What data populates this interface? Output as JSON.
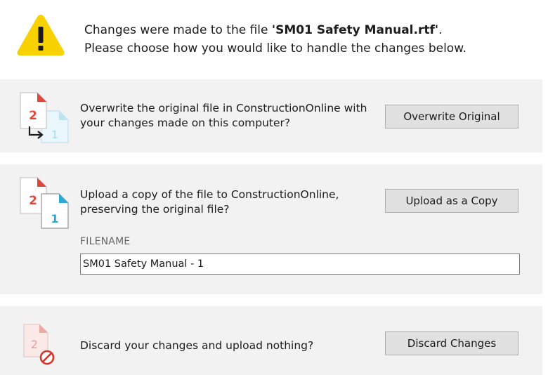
{
  "header": {
    "line1_prefix": "Changes were made to the file ",
    "filename": "'SM01 Safety Manual.rtf'",
    "line1_suffix": ".",
    "line2": "Please choose how you would like to handle the changes below.",
    "icon": "warning-icon"
  },
  "options": {
    "overwrite": {
      "line1": "Overwrite the original file in ConstructionOnline with",
      "line2": "your changes made on this computer?",
      "button_label": "Overwrite Original",
      "icon": "overwrite-file-icon",
      "icon_num_new": "2",
      "icon_num_old": "1"
    },
    "upload_copy": {
      "line1": "Upload a copy of the file to ConstructionOnline,",
      "line2": "preserving the original file?",
      "button_label": "Upload as a Copy",
      "icon": "copy-file-icon",
      "icon_num_new": "2",
      "icon_num_old": "1",
      "filename_label": "FILENAME",
      "filename_value": "SM01 Safety Manual - 1"
    },
    "discard": {
      "line1": "Discard your changes and upload nothing?",
      "button_label": "Discard Changes",
      "icon": "discard-file-icon",
      "icon_num": "2"
    }
  },
  "colors": {
    "warning_yellow": "#f8d100",
    "accent_red": "#e0463a",
    "accent_blue": "#2aa8d8",
    "panel_bg": "#f2f2f2",
    "button_bg": "#e1e1e1"
  }
}
